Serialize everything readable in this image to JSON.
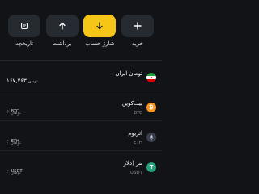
{
  "colors": {
    "background": "#111317",
    "button": "#262a31",
    "accent": "#f5c518",
    "bitcoin": "#f7931a",
    "ethereum": "#8a92b2",
    "tether": "#26a17b"
  },
  "actions": [
    {
      "label": "خرید",
      "icon": "plus-icon"
    },
    {
      "label": "شارژ حساب",
      "icon": "arrow-down-icon"
    },
    {
      "label": "برداشت",
      "icon": "arrow-up-icon"
    },
    {
      "label": "تاریخچه",
      "icon": "history-icon"
    }
  ],
  "assets": [
    {
      "name": "تومان ایران",
      "symbol": "",
      "amount": "۱۶۷,۷۶۳",
      "unit": "تومان",
      "fiat": "",
      "icon": "iran-flag-icon"
    },
    {
      "name": "بیت‌کوین",
      "symbol": "BTC",
      "amount": "۰",
      "unit": "BTC",
      "fiat": "۰ تومان",
      "icon": "bitcoin-icon"
    },
    {
      "name": "اتریوم",
      "symbol": "ETH",
      "amount": "۰",
      "unit": "ETH",
      "fiat": "۰ تومان",
      "icon": "ethereum-icon"
    },
    {
      "name": "تتر (دلار",
      "symbol": "USDT",
      "amount": "۰",
      "unit": "USDT",
      "fiat": "۰ تومان",
      "icon": "tether-icon"
    }
  ]
}
